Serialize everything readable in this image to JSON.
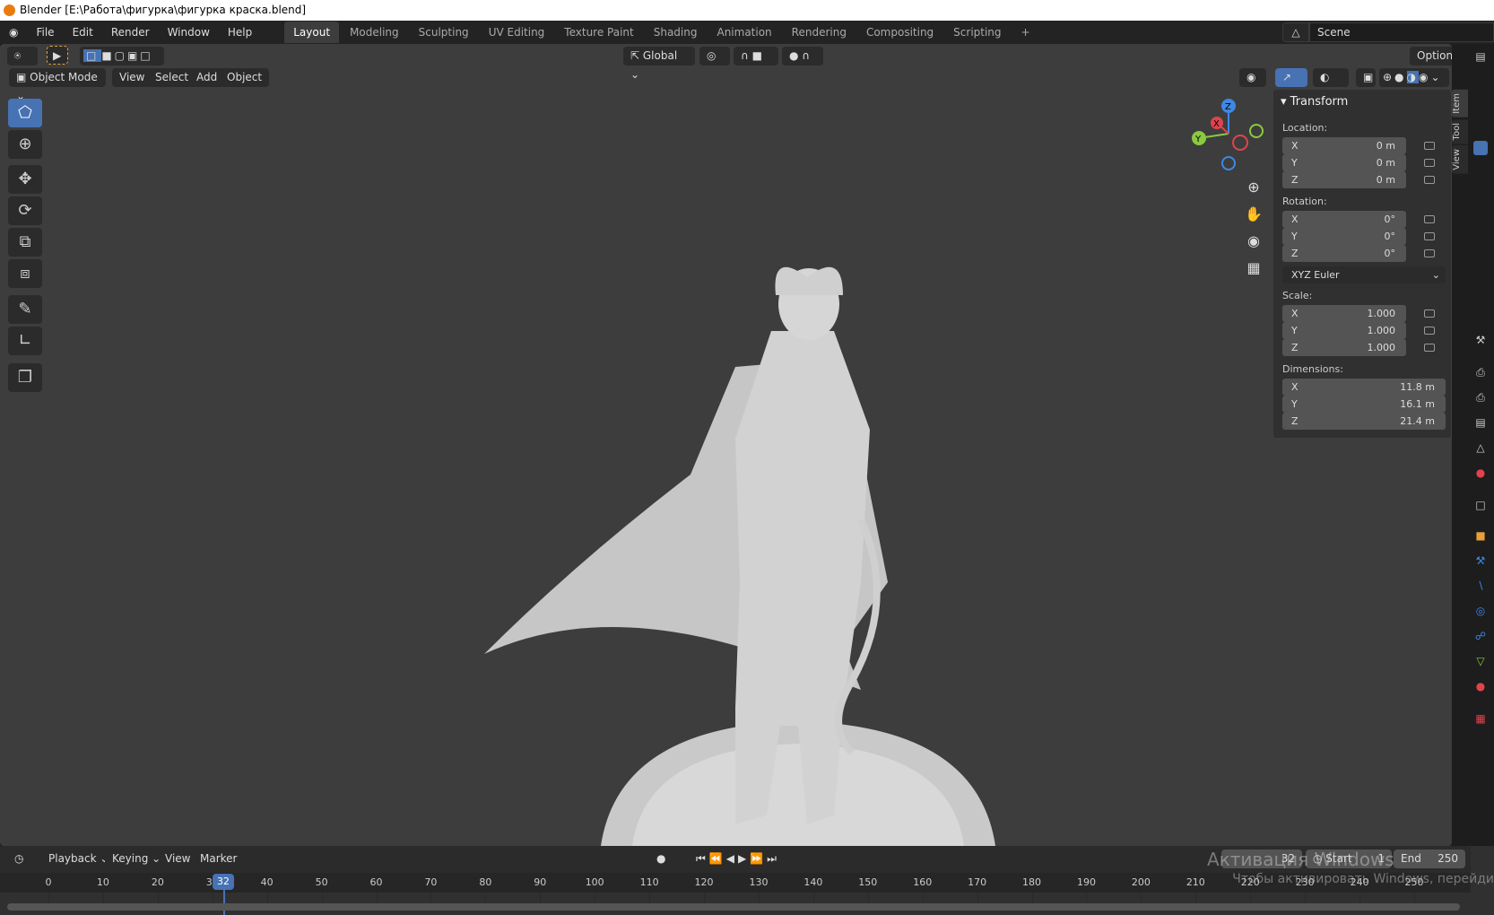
{
  "title": "Blender [E:\\Работа\\фигурка\\фигурка краска.blend]",
  "menu": [
    "File",
    "Edit",
    "Render",
    "Window",
    "Help"
  ],
  "workspaces": [
    {
      "label": "Layout",
      "active": true
    },
    {
      "label": "Modeling"
    },
    {
      "label": "Sculpting"
    },
    {
      "label": "UV Editing"
    },
    {
      "label": "Texture Paint"
    },
    {
      "label": "Shading"
    },
    {
      "label": "Animation"
    },
    {
      "label": "Rendering"
    },
    {
      "label": "Compositing"
    },
    {
      "label": "Scripting"
    },
    {
      "label": "+"
    }
  ],
  "scene": "Scene",
  "header": {
    "orientation": "Global",
    "options": "Options"
  },
  "viewport_header": {
    "mode": "Object Mode",
    "items": [
      "View",
      "Select",
      "Add",
      "Object"
    ]
  },
  "tools": [
    "select-box",
    "cursor",
    "move",
    "rotate",
    "scale",
    "transform",
    "annotate",
    "measure",
    "add-cube"
  ],
  "gizmo": {
    "x": "X",
    "y": "Y",
    "z": "Z"
  },
  "npanel": {
    "title": "Transform",
    "location_label": "Location:",
    "location": [
      {
        "axis": "X",
        "value": "0 m"
      },
      {
        "axis": "Y",
        "value": "0 m"
      },
      {
        "axis": "Z",
        "value": "0 m"
      }
    ],
    "rotation_label": "Rotation:",
    "rotation": [
      {
        "axis": "X",
        "value": "0°"
      },
      {
        "axis": "Y",
        "value": "0°"
      },
      {
        "axis": "Z",
        "value": "0°"
      }
    ],
    "rotation_mode": "XYZ Euler",
    "scale_label": "Scale:",
    "scale": [
      {
        "axis": "X",
        "value": "1.000"
      },
      {
        "axis": "Y",
        "value": "1.000"
      },
      {
        "axis": "Z",
        "value": "1.000"
      }
    ],
    "dimensions_label": "Dimensions:",
    "dimensions": [
      {
        "axis": "X",
        "value": "11.8 m"
      },
      {
        "axis": "Y",
        "value": "16.1 m"
      },
      {
        "axis": "Z",
        "value": "21.4 m"
      }
    ],
    "tabs": [
      "Item",
      "Tool",
      "View"
    ]
  },
  "timeline": {
    "menus": [
      "Playback",
      "Keying",
      "View",
      "Marker"
    ],
    "current_frame": "32",
    "start_label": "Start",
    "start": "1",
    "end_label": "End",
    "end": "250",
    "ticks": [
      0,
      10,
      20,
      30,
      40,
      50,
      60,
      70,
      80,
      90,
      100,
      110,
      120,
      130,
      140,
      150,
      160,
      170,
      180,
      190,
      200,
      210,
      220,
      230,
      240,
      250
    ],
    "playhead": 32
  },
  "watermark": {
    "line1": "Активация Windows",
    "line2": "Чтобы активировать Windows, перейди"
  },
  "colors": {
    "accent": "#4772b3",
    "viewport_bg": "#3d3d3d",
    "playhead": "#4772b3",
    "x_axis": "#e0434d",
    "y_axis": "#8bc940",
    "z_axis": "#3f87e6"
  }
}
